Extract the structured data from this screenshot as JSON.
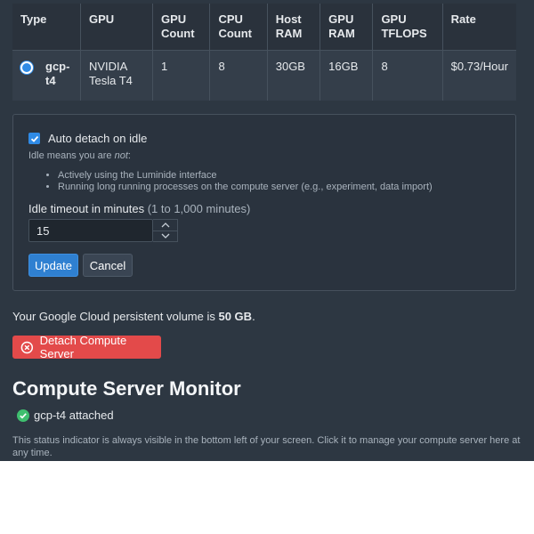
{
  "table": {
    "headers": [
      "Type",
      "GPU",
      "GPU Count",
      "CPU Count",
      "Host RAM",
      "GPU RAM",
      "GPU TFLOPS",
      "Rate"
    ],
    "rows": [
      {
        "type": "gcp-t4",
        "gpu": "NVIDIA Tesla T4",
        "gpu_count": "1",
        "cpu_count": "8",
        "host_ram": "30GB",
        "gpu_ram": "16GB",
        "gpu_tflops": "8",
        "rate": "$0.73/Hour",
        "selected": true
      }
    ]
  },
  "idle": {
    "auto_detach_label": "Auto detach on idle",
    "auto_detach_checked": true,
    "idle_means_prefix": "Idle means you are ",
    "idle_means_emph": "not",
    "idle_means_suffix": ":",
    "conditions": [
      "Actively using the Luminide interface",
      "Running long running processes on the compute server (e.g., experiment, data import)"
    ],
    "timeout_label": "Idle timeout in minutes",
    "timeout_range": "(1 to 1,000 minutes)",
    "timeout_value": "15",
    "update_label": "Update",
    "cancel_label": "Cancel"
  },
  "volume": {
    "prefix": "Your Google Cloud persistent volume is ",
    "size": "50 GB",
    "suffix": "."
  },
  "detach_label": "Detach Compute Server",
  "monitor": {
    "title": "Compute Server Monitor",
    "status": "gcp-t4 attached",
    "note": "This status indicator is always visible in the bottom left of your screen. Click it to manage your compute server here at any time."
  },
  "colors": {
    "accent": "#2f80d1",
    "danger": "#e34a4a",
    "success": "#3fbf6f",
    "background": "#2d3742"
  }
}
